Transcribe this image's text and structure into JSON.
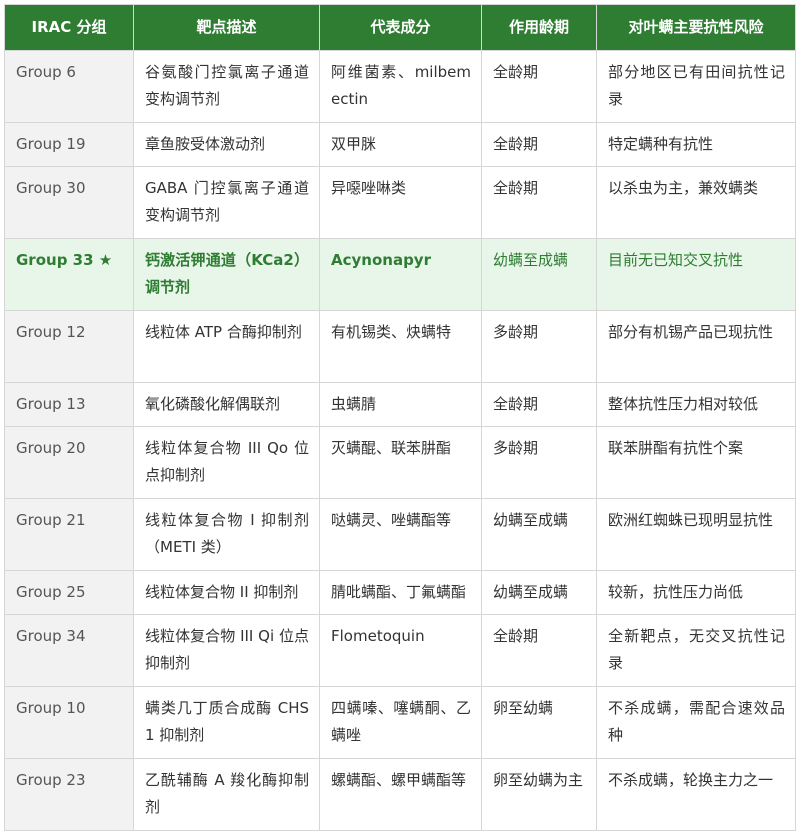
{
  "table": {
    "headers": [
      "IRAC 分组",
      "靶点描述",
      "代表成分",
      "作用龄期",
      "对叶螨主要抗性风险"
    ],
    "rows": [
      {
        "group": "Group 6",
        "target": "谷氨酸门控氯离子通道变构调节剂",
        "ingredients": "阿维菌素、milbemectin",
        "stage": "全龄期",
        "risk": "部分地区已有田间抗性记录"
      },
      {
        "group": "Group 19",
        "target": "章鱼胺受体激动剂",
        "ingredients": "双甲脒",
        "stage": "全龄期",
        "risk": "特定螨种有抗性"
      },
      {
        "group": "Group 30",
        "target": "GABA 门控氯离子通道变构调节剂",
        "ingredients": "异噁唑啉类",
        "stage": "全龄期",
        "risk": "以杀虫为主，兼效螨类"
      },
      {
        "group": "Group 33 ★",
        "target": "钙激活钾通道（KCa2）调节剂",
        "ingredients": "Acynonapyr",
        "stage": "幼螨至成螨",
        "risk": "目前无已知交叉抗性"
      },
      {
        "group": "Group 12",
        "target": "线粒体 ATP 合酶抑制剂",
        "ingredients": "有机锡类、炔螨特",
        "stage": "多龄期",
        "risk": "部分有机锡产品已现抗性"
      },
      {
        "group": "Group 13",
        "target": "氧化磷酸化解偶联剂",
        "ingredients": "虫螨腈",
        "stage": "全龄期",
        "risk": "整体抗性压力相对较低"
      },
      {
        "group": "Group 20",
        "target": "线粒体复合物 III Qo 位点抑制剂",
        "ingredients": "灭螨醌、联苯肼酯",
        "stage": "多龄期",
        "risk": "联苯肼酯有抗性个案"
      },
      {
        "group": "Group 21",
        "target": "线粒体复合物 I 抑制剂（METI 类）",
        "ingredients": "哒螨灵、唑螨酯等",
        "stage": "幼螨至成螨",
        "risk": "欧洲红蜘蛛已现明显抗性"
      },
      {
        "group": "Group 25",
        "target": "线粒体复合物 II 抑制剂",
        "ingredients": "腈吡螨酯、丁氟螨酯",
        "stage": "幼螨至成螨",
        "risk": "较新，抗性压力尚低"
      },
      {
        "group": "Group 34",
        "target": "线粒体复合物 III Qi 位点抑制剂",
        "ingredients": "Flometoquin",
        "stage": "全龄期",
        "risk": "全新靶点，无交叉抗性记录"
      },
      {
        "group": "Group 10",
        "target": "螨类几丁质合成酶 CHS1 抑制剂",
        "ingredients": "四螨嗪、噻螨酮、乙螨唑",
        "stage": "卵至幼螨",
        "risk": "不杀成螨，需配合速效品种"
      },
      {
        "group": "Group 23",
        "target": "乙酰辅酶 A 羧化酶抑制剂",
        "ingredients": "螺螨酯、螺甲螨酯等",
        "stage": "卵至幼螨为主",
        "risk": "不杀成螨，轮换主力之一"
      }
    ]
  },
  "colors": {
    "header_bg": "#2e7d32",
    "highlight_bg": "#e8f5e9",
    "highlight_text": "#2e7d32",
    "group_col_bg": "#f2f2f2"
  }
}
